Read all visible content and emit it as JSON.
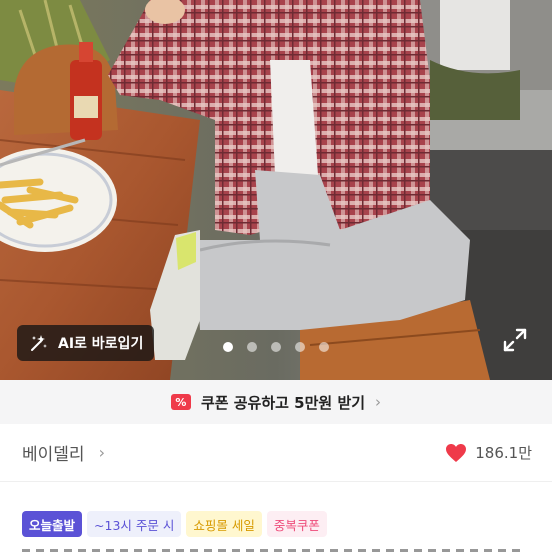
{
  "photo": {
    "ai_button_label": "AI로 바로입기",
    "sparkle_icon": "magic-wand-sparkle-icon",
    "expand_icon": "expand-arrows-icon",
    "carousel": {
      "count": 5,
      "active": 0
    }
  },
  "coupon": {
    "label": "쿠폰 공유하고 5만원 받기",
    "badge": "%",
    "arrow": "›"
  },
  "brand": {
    "name": "베이델리",
    "chevron": "›",
    "likes": "186.1만",
    "heart_color": "#ef3a4a"
  },
  "tags": [
    {
      "label": "오늘출발"
    },
    {
      "label": "~13시 주문 시"
    },
    {
      "label": "쇼핑몰 세일"
    },
    {
      "label": "중복쿠폰"
    }
  ]
}
